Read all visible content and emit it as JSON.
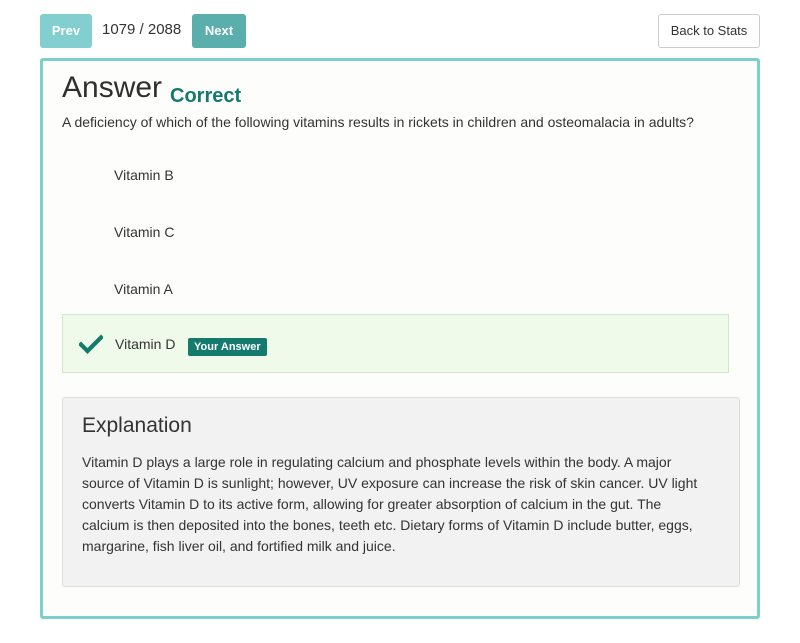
{
  "nav": {
    "prev_label": "Prev",
    "counter": "1079 / 2088",
    "next_label": "Next",
    "back_label": "Back to Stats"
  },
  "answer": {
    "title": "Answer",
    "status": "Correct",
    "status_color": "#137a6d",
    "question": "A deficiency of which of the following vitamins results in rickets in children and osteomalacia in adults?",
    "options": [
      {
        "label": "Vitamin B",
        "selected": false
      },
      {
        "label": "Vitamin C",
        "selected": false
      },
      {
        "label": "Vitamin A",
        "selected": false
      },
      {
        "label": "Vitamin D",
        "selected": true,
        "icon": "checkmark-icon",
        "badge": "Your Answer"
      }
    ]
  },
  "explanation": {
    "title": "Explanation",
    "body": "Vitamin D plays a large role in regulating calcium and phosphate levels within the body. A major source of Vitamin D is sunlight; however, UV exposure can increase the risk of skin cancer. UV light converts Vitamin D to its active form, allowing for greater absorption of calcium in the gut. The calcium is then deposited into the bones, teeth etc. Dietary forms of Vitamin D include butter, eggs, margarine, fish liver oil, and fortified milk and juice."
  },
  "colors": {
    "accent": "#5bbcbc",
    "panel_border": "#7bd0cd",
    "selected_bg": "#effaeb"
  }
}
